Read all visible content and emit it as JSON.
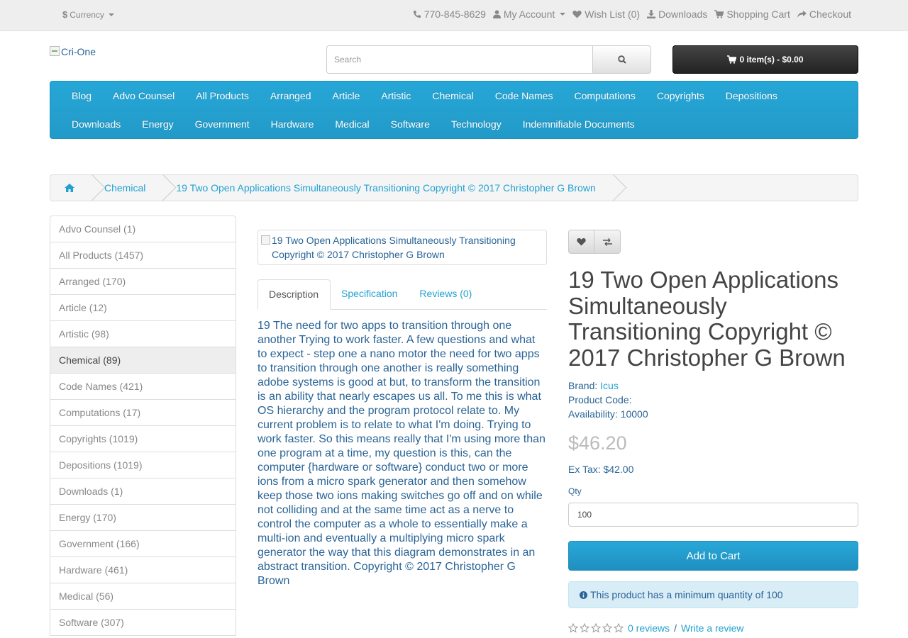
{
  "topbar": {
    "currency_label": "Currency",
    "phone": "770-845-8629",
    "my_account": "My Account",
    "wish_list": "Wish List (0)",
    "downloads": "Downloads",
    "shopping_cart": "Shopping Cart",
    "checkout": "Checkout"
  },
  "header": {
    "logo_alt": "Cri-One",
    "search_placeholder": "Search",
    "cart_summary": "0 item(s) - $0.00"
  },
  "menu": {
    "row1": [
      "Blog",
      "Advo Counsel",
      "All Products",
      "Arranged",
      "Article",
      "Artistic",
      "Chemical",
      "Code Names",
      "Computations",
      "Copyrights",
      "Depositions"
    ],
    "row2": [
      "Downloads",
      "Energy",
      "Government",
      "Hardware",
      "Medical",
      "Software",
      "Technology",
      "Indemnifiable Documents"
    ]
  },
  "breadcrumb": {
    "home_icon": "home-icon",
    "items": [
      "Chemical",
      "19 Two Open Applications Simultaneously Transitioning Copyright © 2017 Christopher G Brown"
    ]
  },
  "sidebar": {
    "categories": [
      "Advo Counsel (1)",
      "All Products (1457)",
      "Arranged (170)",
      "Article (12)",
      "Artistic (98)",
      "Chemical (89)",
      "Code Names (421)",
      "Computations (17)",
      "Copyrights (1019)",
      "Depositions (1019)",
      "Downloads (1)",
      "Energy (170)",
      "Government (166)",
      "Hardware (461)",
      "Medical (56)",
      "Software (307)"
    ],
    "active": "Chemical (89)"
  },
  "product": {
    "image_alt": "19 Two Open Applications Simultaneously Transitioning Copyright © 2017 Christopher G Brown",
    "tabs": [
      "Description",
      "Specification",
      "Reviews (0)"
    ],
    "description": "19 The need for two apps to transition through one another Trying to work faster. A few questions and what to expect - step one a nano motor the need for two apps to transition through one another is really something adobe systems is good at but, to transform the transition is an ability that nearly escapes us all. To me this is what OS hierarchy and the program protocol relate to. My current problem is to relate to what I'm doing. Trying to work faster. So this means really that I'm using more than one program at a time, my question is this, can the computer {hardware or software} conduct two or more ions from a micro spark generator and then somehow keep those two ions making switches go off and on while not colliding and at the same time act as a nerve to control the computer as a whole to essentially make a multi-ion and eventually a multiplying micro spark generator the way that this diagram demonstrates in an abstract transition. Copyright © 2017 Christopher G Brown",
    "title": "19 Two Open Applications Simultaneously Transitioning Copyright © 2017 Christopher G Brown",
    "brand_label": "Brand:",
    "brand": "Icus",
    "product_code_label": "Product Code:",
    "product_code": "",
    "availability_label": "Availability:",
    "availability": "10000",
    "price": "$46.20",
    "ex_tax": "Ex Tax: $42.00",
    "qty_label": "Qty",
    "qty_value": "100",
    "add_to_cart": "Add to Cart",
    "min_qty_notice": "This product has a minimum quantity of 100",
    "reviews_link": "0 reviews",
    "review_separator": "/",
    "write_review": "Write a review",
    "rating": 0,
    "rating_max": 5
  },
  "colors": {
    "accent": "#229ac8",
    "link": "#23a1d1",
    "text_link_dark": "#2a6496",
    "cart_button": "#303030",
    "alert_bg": "#d9edf7"
  }
}
